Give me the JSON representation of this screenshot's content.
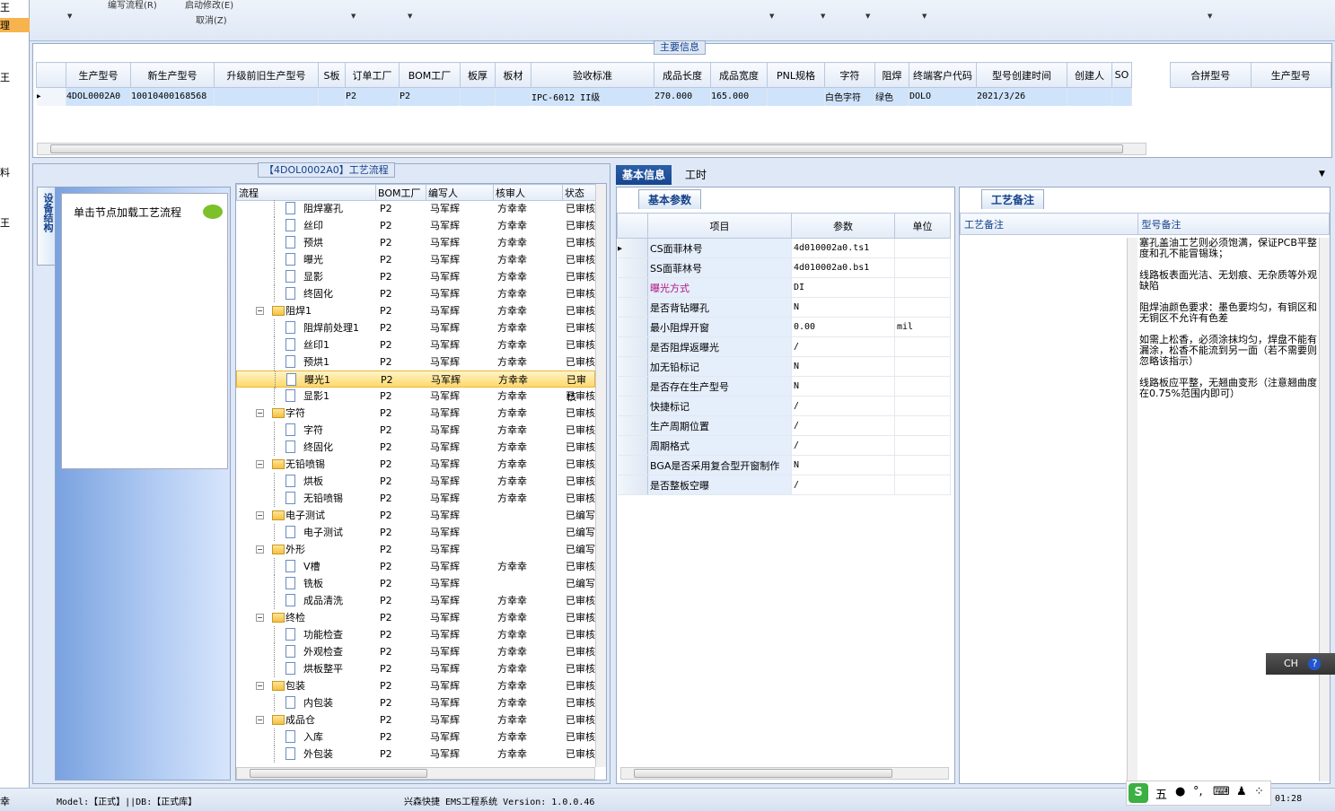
{
  "left_strip": [
    "王",
    "理",
    "王",
    "料",
    "王"
  ],
  "toolbar": {
    "items": [
      "编写流程(R)",
      "启动修改(E)",
      "取消(Z)"
    ]
  },
  "main_info": {
    "title": "主要信息",
    "columns": [
      "生产型号",
      "新生产型号",
      "升级前旧生产型号",
      "S板",
      "订单工厂",
      "BOM工厂",
      "板厚",
      "板材",
      "验收标准",
      "成品长度",
      "成品宽度",
      "PNL规格",
      "字符",
      "阻焊",
      "终端客户代码",
      "型号创建时间",
      "创建人",
      "SO"
    ],
    "row": [
      "4DOL0002A0",
      "10010400168568",
      "",
      "",
      "P2",
      "P2",
      "",
      "",
      "IPC-6012 II级",
      "270.000",
      "165.000",
      "",
      "白色字符",
      "绿色",
      "DOLO",
      "2021/3/26",
      "",
      ""
    ],
    "merge_columns": [
      "合拼型号",
      "生产型号"
    ]
  },
  "process": {
    "title": "【4DOL0002A0】工艺流程",
    "side_tab": "设备结构",
    "nav_text": "单击节点加载工艺流程",
    "columns": [
      "流程",
      "BOM工厂",
      "编写人",
      "核审人",
      "状态"
    ],
    "rows": [
      {
        "name": "阻焊塞孔",
        "level": 2,
        "bom": "P2",
        "writer": "马军辉",
        "reviewer": "方幸幸",
        "status": "已审核"
      },
      {
        "name": "丝印",
        "level": 2,
        "bom": "P2",
        "writer": "马军辉",
        "reviewer": "方幸幸",
        "status": "已审核"
      },
      {
        "name": "预烘",
        "level": 2,
        "bom": "P2",
        "writer": "马军辉",
        "reviewer": "方幸幸",
        "status": "已审核"
      },
      {
        "name": "曝光",
        "level": 2,
        "bom": "P2",
        "writer": "马军辉",
        "reviewer": "方幸幸",
        "status": "已审核"
      },
      {
        "name": "显影",
        "level": 2,
        "bom": "P2",
        "writer": "马军辉",
        "reviewer": "方幸幸",
        "status": "已审核"
      },
      {
        "name": "终固化",
        "level": 2,
        "bom": "P2",
        "writer": "马军辉",
        "reviewer": "方幸幸",
        "status": "已审核"
      },
      {
        "name": "阻焊1",
        "level": 1,
        "bom": "P2",
        "writer": "马军辉",
        "reviewer": "方幸幸",
        "status": "已审核"
      },
      {
        "name": "阻焊前处理1",
        "level": 2,
        "bom": "P2",
        "writer": "马军辉",
        "reviewer": "方幸幸",
        "status": "已审核"
      },
      {
        "name": "丝印1",
        "level": 2,
        "bom": "P2",
        "writer": "马军辉",
        "reviewer": "方幸幸",
        "status": "已审核"
      },
      {
        "name": "预烘1",
        "level": 2,
        "bom": "P2",
        "writer": "马军辉",
        "reviewer": "方幸幸",
        "status": "已审核"
      },
      {
        "name": "曝光1",
        "level": 2,
        "bom": "P2",
        "writer": "马军辉",
        "reviewer": "方幸幸",
        "status": "已审核",
        "selected": true
      },
      {
        "name": "显影1",
        "level": 2,
        "bom": "P2",
        "writer": "马军辉",
        "reviewer": "方幸幸",
        "status": "已审核"
      },
      {
        "name": "字符",
        "level": 1,
        "bom": "P2",
        "writer": "马军辉",
        "reviewer": "方幸幸",
        "status": "已审核"
      },
      {
        "name": "字符",
        "level": 2,
        "bom": "P2",
        "writer": "马军辉",
        "reviewer": "方幸幸",
        "status": "已审核"
      },
      {
        "name": "终固化",
        "level": 2,
        "bom": "P2",
        "writer": "马军辉",
        "reviewer": "方幸幸",
        "status": "已审核"
      },
      {
        "name": "无铅喷锡",
        "level": 1,
        "bom": "P2",
        "writer": "马军辉",
        "reviewer": "方幸幸",
        "status": "已审核"
      },
      {
        "name": "烘板",
        "level": 2,
        "bom": "P2",
        "writer": "马军辉",
        "reviewer": "方幸幸",
        "status": "已审核"
      },
      {
        "name": "无铅喷锡",
        "level": 2,
        "bom": "P2",
        "writer": "马军辉",
        "reviewer": "方幸幸",
        "status": "已审核"
      },
      {
        "name": "电子测试",
        "level": 1,
        "bom": "P2",
        "writer": "马军辉",
        "reviewer": "",
        "status": "已编写"
      },
      {
        "name": "电子测试",
        "level": 2,
        "bom": "P2",
        "writer": "马军辉",
        "reviewer": "",
        "status": "已编写"
      },
      {
        "name": "外形",
        "level": 1,
        "bom": "P2",
        "writer": "马军辉",
        "reviewer": "",
        "status": "已编写"
      },
      {
        "name": "V槽",
        "level": 2,
        "bom": "P2",
        "writer": "马军辉",
        "reviewer": "方幸幸",
        "status": "已审核"
      },
      {
        "name": "铣板",
        "level": 2,
        "bom": "P2",
        "writer": "马军辉",
        "reviewer": "",
        "status": "已编写"
      },
      {
        "name": "成品清洗",
        "level": 2,
        "bom": "P2",
        "writer": "马军辉",
        "reviewer": "方幸幸",
        "status": "已审核"
      },
      {
        "name": "终检",
        "level": 1,
        "bom": "P2",
        "writer": "马军辉",
        "reviewer": "方幸幸",
        "status": "已审核"
      },
      {
        "name": "功能检查",
        "level": 2,
        "bom": "P2",
        "writer": "马军辉",
        "reviewer": "方幸幸",
        "status": "已审核"
      },
      {
        "name": "外观检查",
        "level": 2,
        "bom": "P2",
        "writer": "马军辉",
        "reviewer": "方幸幸",
        "status": "已审核"
      },
      {
        "name": "烘板整平",
        "level": 2,
        "bom": "P2",
        "writer": "马军辉",
        "reviewer": "方幸幸",
        "status": "已审核"
      },
      {
        "name": "包装",
        "level": 1,
        "bom": "P2",
        "writer": "马军辉",
        "reviewer": "方幸幸",
        "status": "已审核"
      },
      {
        "name": "内包装",
        "level": 2,
        "bom": "P2",
        "writer": "马军辉",
        "reviewer": "方幸幸",
        "status": "已审核"
      },
      {
        "name": "成品仓",
        "level": 1,
        "bom": "P2",
        "writer": "马军辉",
        "reviewer": "方幸幸",
        "status": "已审核"
      },
      {
        "name": "入库",
        "level": 2,
        "bom": "P2",
        "writer": "马军辉",
        "reviewer": "方幸幸",
        "status": "已审核"
      },
      {
        "name": "外包装",
        "level": 2,
        "bom": "P2",
        "writer": "马军辉",
        "reviewer": "方幸幸",
        "status": "已审核"
      }
    ]
  },
  "right": {
    "tabs": [
      "基本信息",
      "工时"
    ],
    "basic_tab": "基本参数",
    "param_columns": [
      "项目",
      "参数",
      "单位"
    ],
    "params": [
      {
        "item": "CS面菲林号",
        "value": "4d010002a0.ts1",
        "unit": ""
      },
      {
        "item": "SS面菲林号",
        "value": "4d010002a0.bs1",
        "unit": ""
      },
      {
        "item": "曝光方式",
        "value": "DI",
        "unit": "",
        "highlight": "#b0127e"
      },
      {
        "item": "是否背钻曝孔",
        "value": "N",
        "unit": ""
      },
      {
        "item": "最小阻焊开窗",
        "value": "0.00",
        "unit": "mil"
      },
      {
        "item": "是否阻焊返曝光",
        "value": "/",
        "unit": ""
      },
      {
        "item": "加无铅标记",
        "value": "N",
        "unit": ""
      },
      {
        "item": "是否存在生产型号",
        "value": "N",
        "unit": ""
      },
      {
        "item": "快捷标记",
        "value": "/",
        "unit": ""
      },
      {
        "item": "生产周期位置",
        "value": "/",
        "unit": ""
      },
      {
        "item": "周期格式",
        "value": "/",
        "unit": ""
      },
      {
        "item": "BGA是否采用复合型开窗制作",
        "value": "N",
        "unit": ""
      },
      {
        "item": "是否整板空曝",
        "value": "/",
        "unit": ""
      }
    ],
    "remark_tab": "工艺备注",
    "remark_columns": [
      "工艺备注",
      "型号备注"
    ],
    "type_remark": "塞孔盖油工艺则必须饱满，保证PCB平整度和孔不能冒锡珠；\n\n线路板表面光洁、无划痕、无杂质等外观缺陷\n\n阻焊油颜色要求：墨色要均匀，有铜区和无铜区不允许有色差\n\n如需上松香，必须涂抹均匀，焊盘不能有漏涂，松香不能流到另一面（若不需要则忽略该指示）\n\n线路板应平整，无翘曲变形（注意翘曲度在0.75%范围内即可）"
  },
  "status": {
    "left": "幸",
    "model": "Model:【正式】||DB:【正式库】",
    "center": "兴森快捷 EMS工程系统 Version: 1.0.0.46",
    "time": "01:28"
  },
  "ime": {
    "label": "五",
    "ch": "CH"
  },
  "colors": {
    "accent": "#16458f",
    "selection": "#ffd86a",
    "highlight_text": "#b0127e"
  }
}
